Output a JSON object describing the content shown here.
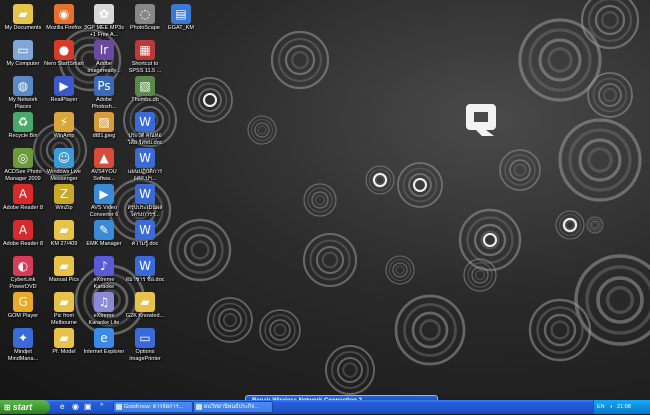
{
  "desktop": {
    "icons": [
      {
        "label": "My Documents",
        "icon": "folder-icon",
        "color": "#e8c34a"
      },
      {
        "label": "Mozilla Firefox",
        "icon": "firefox-icon",
        "color": "#e8702a"
      },
      {
        "label": "3GP MEE MP3s +1 Free A...",
        "icon": "media-converter-icon",
        "color": "#d8d8d8"
      },
      {
        "label": "PhotoScape",
        "icon": "photoscape-icon",
        "color": "#888888"
      },
      {
        "label": "EGAT_KM",
        "icon": "document-icon",
        "color": "#3a78d8"
      },
      {
        "label": "My Computer",
        "icon": "computer-icon",
        "color": "#7fa8d8"
      },
      {
        "label": "Nero StartSmart",
        "icon": "nero-icon",
        "color": "#d83a2a"
      },
      {
        "label": "Adobe Imageready...",
        "icon": "adobe-imageready-icon",
        "color": "#6a4aa0"
      },
      {
        "label": "Shortcut to SPSS 11.5 ...",
        "icon": "spss-icon",
        "color": "#b83a3a"
      },
      {
        "label": "My Network Places",
        "icon": "network-icon",
        "color": "#5a8ac8"
      },
      {
        "label": "RealPlayer",
        "icon": "realplayer-icon",
        "color": "#3a58c8"
      },
      {
        "label": "Adobe Photosh...",
        "icon": "photoshop-icon",
        "color": "#3a6ab8"
      },
      {
        "label": "Thumbs.db",
        "icon": "thumbs-db-icon",
        "color": "#5a8a4a"
      },
      {
        "label": "Recycle Bin",
        "icon": "recycle-bin-icon",
        "color": "#4aa86a"
      },
      {
        "label": "WinAmp",
        "icon": "winamp-icon",
        "color": "#d8a83a"
      },
      {
        "label": "dt81.jpeg",
        "icon": "image-file-icon",
        "color": "#d89a3a"
      },
      {
        "label": "ประวัติ คุณท่อ วิลัย ร์สพบ.doc",
        "icon": "word-doc-icon",
        "color": "#3a6ad8"
      },
      {
        "label": "ACDSee Photo Manager 2009",
        "icon": "acdsee-icon",
        "color": "#6a9a3a"
      },
      {
        "label": "Windows Live Messenger",
        "icon": "messenger-icon",
        "color": "#3a9ad8"
      },
      {
        "label": "AVS4YOU Softwa...",
        "icon": "avs4you-icon",
        "color": "#d84a3a"
      },
      {
        "label": "แผนปฏิบัติการ อศศ.ปฯ...",
        "icon": "word-doc-icon",
        "color": "#3a6ad8"
      },
      {
        "label": "Adobe Reader 8",
        "icon": "adobe-reader-icon",
        "color": "#d82a2a"
      },
      {
        "label": "WinZip",
        "icon": "winzip-icon",
        "color": "#c8a82a"
      },
      {
        "label": "AVS Video Converter 6",
        "icon": "avs-video-icon",
        "color": "#3a8ad8"
      },
      {
        "label": "สรุปประเมินผล โครงการฯ...",
        "icon": "word-doc-icon",
        "color": "#3a6ad8"
      },
      {
        "label": "Adobe Reader 8",
        "icon": "adobe-reader-icon",
        "color": "#d82a2a"
      },
      {
        "label": "KM 27/409",
        "icon": "folder-icon",
        "color": "#e8c34a"
      },
      {
        "label": "EMK Manager",
        "icon": "emk-manager-icon",
        "color": "#3a8ad8"
      },
      {
        "label": "ความรู้.doc",
        "icon": "word-doc-icon",
        "color": "#3a6ad8"
      },
      {
        "label": "CyberLink PowerDVD",
        "icon": "powerdvd-icon",
        "color": "#d83a5a"
      },
      {
        "label": "Manual Pics",
        "icon": "folder-icon",
        "color": "#e8c34a"
      },
      {
        "label": "eXtreme Karaoke",
        "icon": "karaoke-icon",
        "color": "#5a5ad8"
      },
      {
        "label": "สมาชาร ชื่อ.doc",
        "icon": "word-doc-icon",
        "color": "#3a6ad8"
      },
      {
        "label": "GOM Player",
        "icon": "gom-player-icon",
        "color": "#e8a82a"
      },
      {
        "label": "Pic from Melbourne",
        "icon": "folder-icon",
        "color": "#e8c34a"
      },
      {
        "label": "eXtreme Karaoke Lite",
        "icon": "karaoke-lite-icon",
        "color": "#8a8ad8"
      },
      {
        "label": "G2K Knowled...",
        "icon": "folder-icon",
        "color": "#e8c34a"
      },
      {
        "label": "Mindjet MindMana...",
        "icon": "mindjet-icon",
        "color": "#3a6ad8"
      },
      {
        "label": "Pf. Model",
        "icon": "folder-icon",
        "color": "#e8c34a"
      },
      {
        "label": "Internet Explorer",
        "icon": "internet-explorer-icon",
        "color": "#3a8ae8"
      },
      {
        "label": "Options ImagePrinter",
        "icon": "options-window-icon",
        "color": "#3a6ad8"
      }
    ]
  },
  "balloon": {
    "title": "Repair Wireless Network Connection 2"
  },
  "taskbar": {
    "start_label": "start",
    "quick_launch": [
      "ie-quicklaunch-icon",
      "firefox-quicklaunch-icon",
      "show-desktop-icon"
    ],
    "tasks": [
      {
        "label": "GotoKnow: ตารจัดการ..."
      },
      {
        "label": "ผนวิทยานิพนธ์ประกิจ..."
      }
    ],
    "tray": {
      "language": "EN",
      "clock": "21:08"
    }
  },
  "colors": {
    "taskbar": "#245edb",
    "start": "#3c9a2d",
    "tray": "#0c8ae0"
  }
}
